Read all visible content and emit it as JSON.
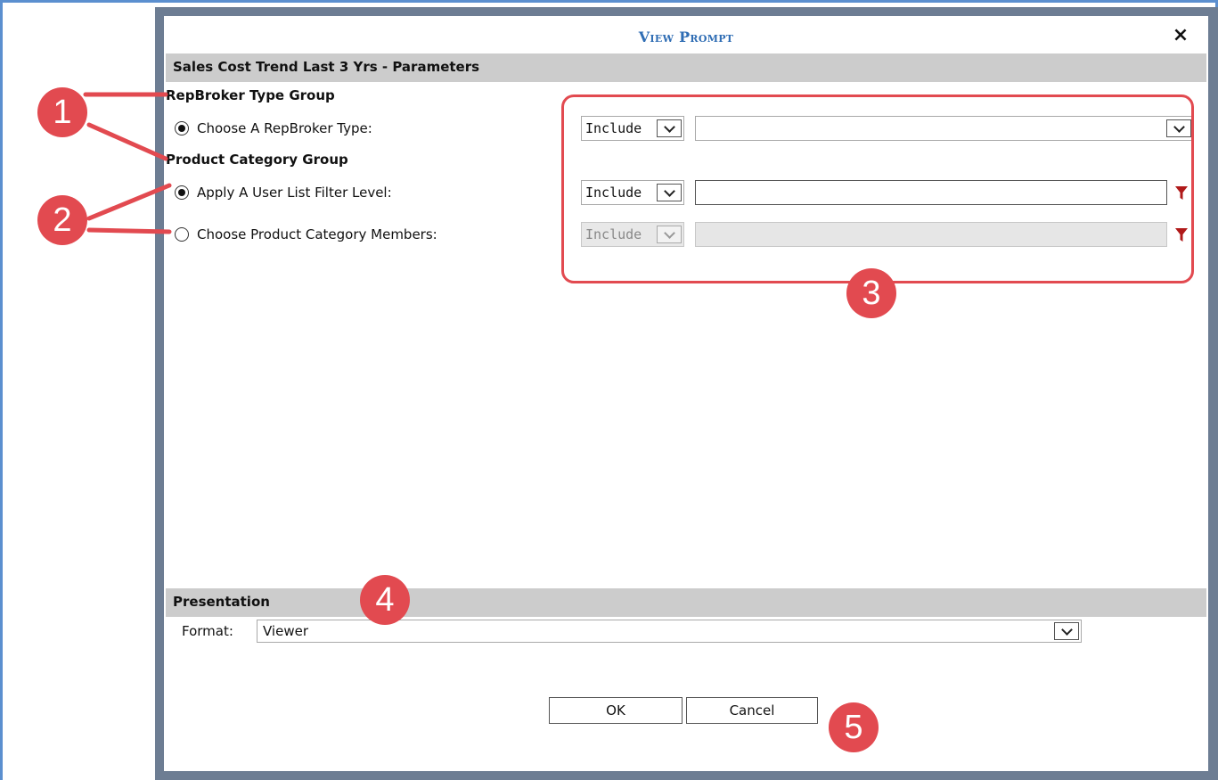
{
  "dialog": {
    "title": "View Prompt",
    "close_glyph": "×"
  },
  "parameters": {
    "header": "Sales Cost Trend Last 3 Yrs - Parameters",
    "groups": [
      {
        "label": "RepBroker Type Group",
        "rows": [
          {
            "label": "Choose A RepBroker Type:",
            "selected": true,
            "include": "Include",
            "enabled": true,
            "value": ""
          }
        ]
      },
      {
        "label": "Product Category Group",
        "rows": [
          {
            "label": "Apply A User List Filter Level:",
            "selected": true,
            "include": "Include",
            "enabled": true,
            "value": ""
          },
          {
            "label": "Choose Product Category Members:",
            "selected": false,
            "include": "Include",
            "enabled": false,
            "value": ""
          }
        ]
      }
    ]
  },
  "presentation": {
    "header": "Presentation",
    "format_label": "Format:",
    "format_value": "Viewer"
  },
  "buttons": {
    "ok": "OK",
    "cancel": "Cancel"
  },
  "annotations": {
    "callouts": [
      "1",
      "2",
      "3",
      "4",
      "5"
    ],
    "color": "#e24a50"
  },
  "colors": {
    "title": "#2f6db4",
    "section_header_bg": "#cccccc",
    "funnel": "#b01919",
    "frame": "#5b8fcf"
  },
  "icons": [
    "close-icon",
    "chevron-down-icon",
    "filter-icon"
  ]
}
